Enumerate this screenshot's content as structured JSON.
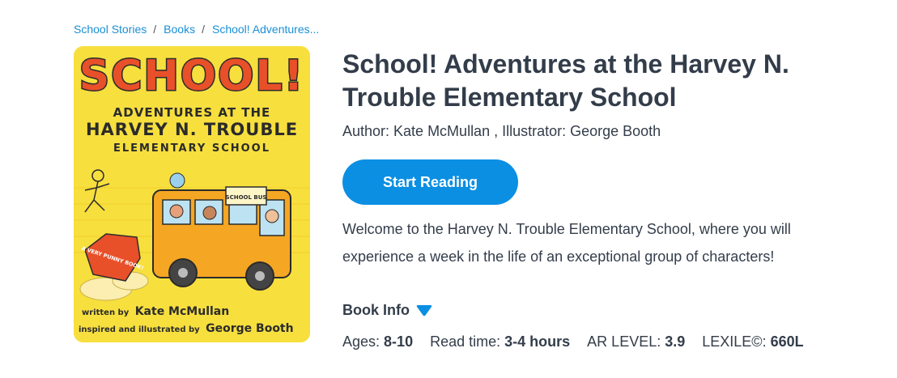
{
  "breadcrumb": {
    "items": [
      "School Stories",
      "Books",
      "School! Adventures..."
    ],
    "separator": "/"
  },
  "cover": {
    "title_line1": "SCHOOL!",
    "title_line2": "ADVENTURES AT THE",
    "title_line3": "HARVEY N. TROUBLE",
    "title_line4": "ELEMENTARY SCHOOL",
    "badge": "A VERY PUNNY BOOK!",
    "bus_sign": "SCHOOL BUS",
    "written_by": "written by",
    "author": "Kate McMullan",
    "illustrated_by": "inspired and illustrated by",
    "illustrator": "George Booth"
  },
  "book": {
    "title": "School! Adventures at the Harvey N. Trouble Elementary School",
    "author_line": "Author: Kate McMullan , Illustrator: George Booth",
    "start_label": "Start Reading",
    "description": "Welcome to the Harvey N. Trouble Elementary School, where you will experience a week in the life of an exceptional group of characters!",
    "info_label": "Book Info"
  },
  "stats": {
    "ages_label": "Ages:",
    "ages_value": "8-10",
    "read_label": "Read time:",
    "read_value": "3-4 hours",
    "ar_label": "AR LEVEL:",
    "ar_value": "3.9",
    "lexile_label": "LEXILE©:",
    "lexile_value": "660L"
  },
  "colors": {
    "accent": "#0b8fe3",
    "link": "#1a8fd6",
    "text": "#333d4a",
    "cover_bg": "#f7df3e"
  }
}
